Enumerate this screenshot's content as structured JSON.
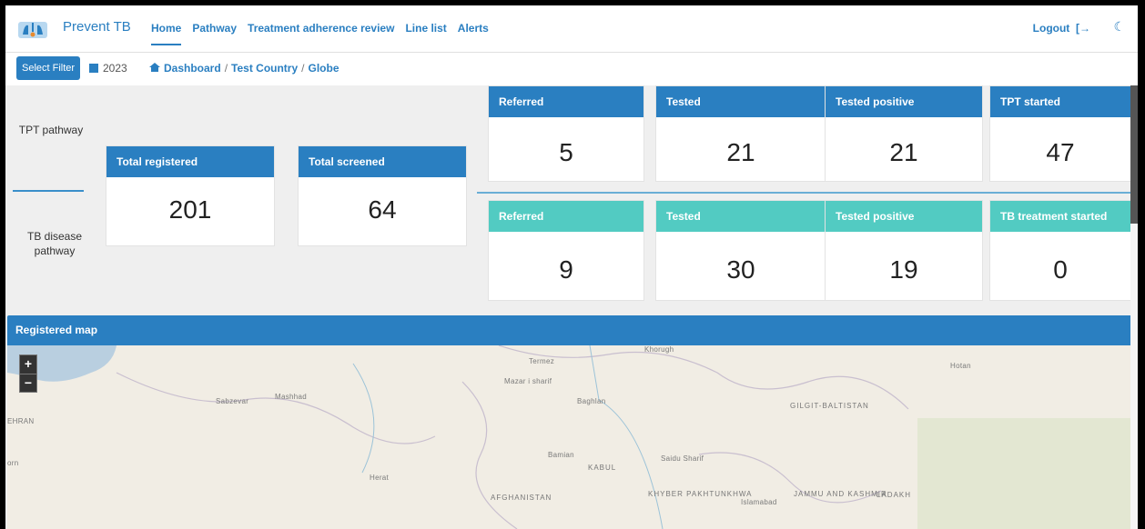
{
  "header": {
    "brand": "Prevent TB",
    "nav": [
      "Home",
      "Pathway",
      "Treatment adherence review",
      "Line list",
      "Alerts"
    ],
    "logout": "Logout"
  },
  "toolbar": {
    "filter_label": "Select Filter",
    "year": "2023",
    "breadcrumb": [
      "Dashboard",
      "Test Country",
      "Globe"
    ]
  },
  "pathways": {
    "tpt_label": "TPT pathway",
    "tb_label": "TB disease pathway"
  },
  "summary": {
    "total_registered": {
      "label": "Total registered",
      "value": "201"
    },
    "total_screened": {
      "label": "Total screened",
      "value": "64"
    }
  },
  "tpt_cards": [
    {
      "label": "Referred",
      "value": "5"
    },
    {
      "label": "Tested",
      "value": "21"
    },
    {
      "label": "Tested positive",
      "value": "21"
    },
    {
      "label": "TPT started",
      "value": "47"
    }
  ],
  "tb_cards": [
    {
      "label": "Referred",
      "value": "9"
    },
    {
      "label": "Tested",
      "value": "30"
    },
    {
      "label": "Tested positive",
      "value": "19"
    },
    {
      "label": "TB treatment started",
      "value": "0"
    }
  ],
  "map": {
    "title": "Registered map",
    "zoom_in": "+",
    "zoom_out": "−",
    "places": [
      "Termez",
      "Khorugh",
      "Mazar i sharif",
      "Hotan",
      "Sabzevar",
      "Mashhad",
      "Baghlan",
      "GILGIT-BALTISTAN",
      "EHRAN",
      "Bamian",
      "Saidu Sharif",
      "KABUL",
      "Herat",
      "AFGHANISTAN",
      "KHYBER PAKHTUNKHWA",
      "Islamabad",
      "JAMMU AND KASHMIR",
      "LADAKH",
      "orn"
    ]
  },
  "colors": {
    "primary": "#2a7fc1",
    "teal": "#52cbc2"
  }
}
